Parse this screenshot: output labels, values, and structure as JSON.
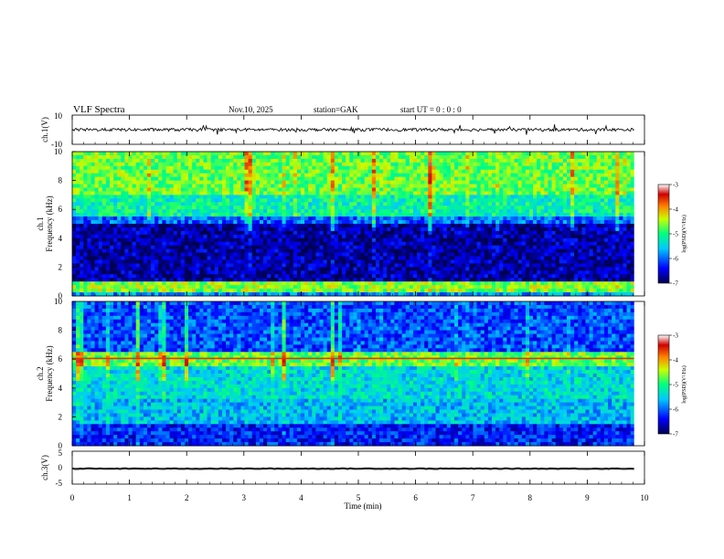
{
  "header": {
    "title": "VLF  Spectra",
    "date": "Nov.10, 2025",
    "station": "station=GAK",
    "start": "start  UT  =    0  : 0   : 0"
  },
  "chart_data": [
    {
      "type": "line",
      "name": "ch1-waveform",
      "ylabel": "ch.1(V)",
      "ylim": [
        -10,
        10
      ],
      "yticks": [
        "10",
        "-10"
      ],
      "xlim": [
        0,
        10
      ],
      "approx_level": 0,
      "approx_amplitude": 2.5
    },
    {
      "type": "heatmap",
      "name": "ch1-spectrogram",
      "ylabel": "ch.1\nFrequency (kHz)",
      "ylabel_line1": "ch.1",
      "ylabel_line2": "Frequency  (kHz)",
      "ylim": [
        0,
        10
      ],
      "yticks": [
        "0",
        "2",
        "4",
        "6",
        "8",
        "10"
      ],
      "xlim": [
        0,
        9.82
      ],
      "colorbar": {
        "range": [
          -7,
          -3
        ],
        "ticks": [
          "-3",
          "-4",
          "-5",
          "-6",
          "-7"
        ],
        "label": "log(PSD)(V²/Hz)"
      },
      "bands_log_psd": [
        {
          "from_khz": 0.0,
          "to_khz": 0.2,
          "value": -5.8
        },
        {
          "from_khz": 0.2,
          "to_khz": 0.9,
          "value": -4.6
        },
        {
          "from_khz": 0.9,
          "to_khz": 4.9,
          "value": -6.7
        },
        {
          "from_khz": 4.9,
          "to_khz": 5.6,
          "value": -6.0
        },
        {
          "from_khz": 5.6,
          "to_khz": 7.0,
          "value": -5.2
        },
        {
          "from_khz": 7.0,
          "to_khz": 10.0,
          "value": -4.7
        }
      ]
    },
    {
      "type": "heatmap",
      "name": "ch2-spectrogram",
      "ylabel_line1": "ch.2",
      "ylabel_line2": "Frequency  (kHz)",
      "ylim": [
        0,
        10
      ],
      "yticks": [
        "0",
        "2",
        "4",
        "6",
        "8",
        "10"
      ],
      "xlim": [
        0,
        9.82
      ],
      "colorbar": {
        "range": [
          -7,
          -3
        ],
        "ticks": [
          "-3",
          "-4",
          "-5",
          "-6",
          "-7"
        ],
        "label": "log(PSD)(V²/Hz)"
      },
      "bands_log_psd": [
        {
          "from_khz": 0.0,
          "to_khz": 1.5,
          "value": -6.3
        },
        {
          "from_khz": 1.5,
          "to_khz": 3.3,
          "value": -5.6
        },
        {
          "from_khz": 3.3,
          "to_khz": 5.5,
          "value": -5.4
        },
        {
          "from_khz": 5.5,
          "to_khz": 6.5,
          "value": -4.7
        },
        {
          "from_khz": 6.5,
          "to_khz": 10.0,
          "value": -6.1
        }
      ],
      "line_6khz_log_psd": -3.6
    },
    {
      "type": "line",
      "name": "ch3-waveform",
      "ylabel": "ch.3(V)",
      "ylim": [
        -5,
        5
      ],
      "yticks": [
        "5",
        "0",
        "-5"
      ],
      "xlim": [
        0,
        10
      ],
      "approx_level": -0.3
    }
  ],
  "xaxis": {
    "label": "Time  (min)",
    "range": [
      0,
      10
    ],
    "ticks": [
      "0",
      "1",
      "2",
      "3",
      "4",
      "5",
      "6",
      "7",
      "8",
      "9",
      "10"
    ]
  },
  "colors": {
    "waveform": "#111111",
    "colormap": [
      "#00006a",
      "#0000ff",
      "#00c8ff",
      "#00ff80",
      "#ffff00",
      "#ff6000",
      "#c80000"
    ]
  }
}
